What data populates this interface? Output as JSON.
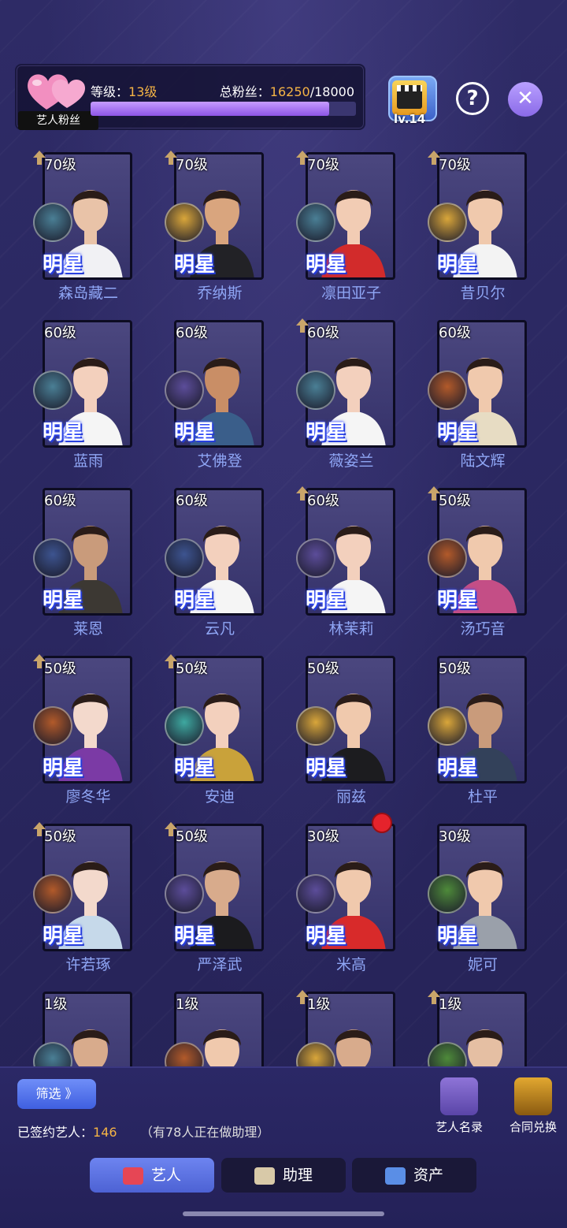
{
  "header": {
    "fan_tag": "艺人粉丝",
    "level_label": "等级：",
    "level_value": "13级",
    "fans_label": "总粉丝：",
    "fans_current": "16250",
    "fans_max": "/18000",
    "fans_progress": 0.9,
    "badge_level": "lv.14",
    "help_icon": "?",
    "close_icon": "✕"
  },
  "cards": [
    {
      "level": "70级",
      "up": true,
      "name": "森岛藏二",
      "icon": "ufo",
      "skin": "#e9c3a8",
      "cloth": "#f1f1f4"
    },
    {
      "level": "70级",
      "up": true,
      "name": "乔纳斯",
      "icon": "soldier",
      "skin": "#d9a57e",
      "cloth": "#222226"
    },
    {
      "level": "70级",
      "up": true,
      "name": "凛田亚子",
      "icon": "ufo",
      "skin": "#f2ccb4",
      "cloth": "#d22b2b"
    },
    {
      "level": "70级",
      "up": true,
      "name": "昔贝尔",
      "icon": "soldier",
      "skin": "#f0c9ad",
      "cloth": "#f3f3f3"
    },
    {
      "level": "60级",
      "up": false,
      "name": "蓝雨",
      "icon": "ufo",
      "skin": "#f3d0bd",
      "cloth": "#f5f5f5"
    },
    {
      "level": "60级",
      "up": false,
      "name": "艾佛登",
      "icon": "magnify",
      "skin": "#c98e66",
      "cloth": "#3a5e8a"
    },
    {
      "level": "60级",
      "up": true,
      "name": "薇姿兰",
      "icon": "ufo",
      "skin": "#f3d0bd",
      "cloth": "#f5f5f5"
    },
    {
      "level": "60级",
      "up": false,
      "name": "陆文辉",
      "icon": "silhouette",
      "skin": "#f0c9ad",
      "cloth": "#e7dcc3"
    },
    {
      "level": "60级",
      "up": false,
      "name": "莱恩",
      "icon": "ship",
      "skin": "#c99b7b",
      "cloth": "#3c3833"
    },
    {
      "level": "60级",
      "up": false,
      "name": "云凡",
      "icon": "ship",
      "skin": "#f3d0bd",
      "cloth": "#f5f5f5"
    },
    {
      "level": "60级",
      "up": true,
      "name": "林茉莉",
      "icon": "magnify",
      "skin": "#f3d0bd",
      "cloth": "#f5f5f5"
    },
    {
      "level": "50级",
      "up": true,
      "name": "汤巧音",
      "icon": "silhouette",
      "skin": "#f0c9ad",
      "cloth": "#c44e86"
    },
    {
      "level": "50级",
      "up": true,
      "name": "廖冬华",
      "icon": "silhouette",
      "skin": "#f3d9cc",
      "cloth": "#7b3aa5"
    },
    {
      "level": "50级",
      "up": true,
      "name": "安迪",
      "icon": "dancer",
      "skin": "#f3d0bd",
      "cloth": "#c9a23a"
    },
    {
      "level": "50级",
      "up": false,
      "name": "丽兹",
      "icon": "soldier",
      "skin": "#f0c9ad",
      "cloth": "#1c1c1f"
    },
    {
      "level": "50级",
      "up": false,
      "name": "杜平",
      "icon": "soldier",
      "skin": "#c99b7b",
      "cloth": "#33415a"
    },
    {
      "level": "50级",
      "up": true,
      "name": "许若琢",
      "icon": "silhouette",
      "skin": "#f3d9cc",
      "cloth": "#c6d9ea"
    },
    {
      "level": "50级",
      "up": true,
      "name": "严泽武",
      "icon": "magnify",
      "skin": "#d8ab8c",
      "cloth": "#1b1b1e"
    },
    {
      "level": "30级",
      "up": false,
      "name": "米高",
      "icon": "magnify",
      "skin": "#f0c9ad",
      "cloth": "#d82a2a",
      "dot": true
    },
    {
      "level": "30级",
      "up": false,
      "name": "妮可",
      "icon": "statue",
      "skin": "#f0c9ad",
      "cloth": "#9aa0aa"
    },
    {
      "level": "1级",
      "up": false,
      "name": "",
      "icon": "ufo",
      "skin": "#d8ab8c",
      "cloth": "#2d3a56"
    },
    {
      "level": "1级",
      "up": false,
      "name": "",
      "icon": "silhouette",
      "skin": "#f0c9ad",
      "cloth": "#3a3a3a"
    },
    {
      "level": "1级",
      "up": true,
      "name": "",
      "icon": "soldier",
      "skin": "#d8ab8c",
      "cloth": "#6a5d45"
    },
    {
      "level": "1级",
      "up": true,
      "name": "",
      "icon": "statue",
      "skin": "#e5bfa3",
      "cloth": "#2d3a56"
    }
  ],
  "star_label": "明星",
  "bottom": {
    "filter_label": "筛选 》",
    "signed_label": "已签约艺人：",
    "signed_count": "146",
    "assist_note": "（有78人正在做助理）",
    "tools": [
      {
        "label": "艺人名录",
        "icon": "directory-book-icon",
        "color": "#8e74d8"
      },
      {
        "label": "合同兑换",
        "icon": "contract-folder-icon",
        "color": "#e2a830"
      }
    ],
    "tabs": [
      {
        "label": "艺人",
        "active": true,
        "icon": "artist-icon",
        "color": "#e64655"
      },
      {
        "label": "助理",
        "active": false,
        "icon": "assistant-icon",
        "color": "#d8c9a8"
      },
      {
        "label": "资产",
        "active": false,
        "icon": "assets-icon",
        "color": "#5a8ee6"
      }
    ]
  },
  "colors": {
    "accent": "#f5b445",
    "name_text": "#8fa6f5",
    "bar_fill": "#a877f2"
  }
}
